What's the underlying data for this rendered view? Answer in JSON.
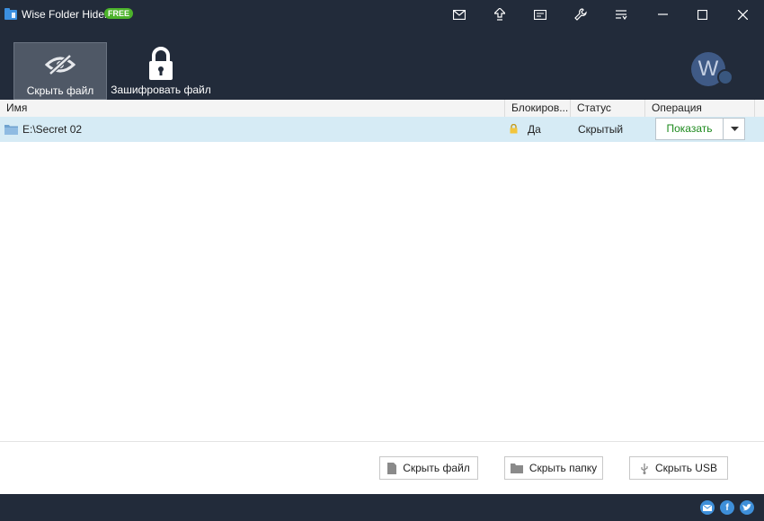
{
  "app": {
    "title": "Wise Folder Hider",
    "badge": "FREE"
  },
  "titlebar_icons": [
    "mail-icon",
    "upgrade-icon",
    "feedback-icon",
    "settings-icon",
    "menu-icon"
  ],
  "window_controls": [
    "minimize",
    "maximize",
    "close"
  ],
  "toolbar": {
    "hide_file": "Скрыть файл",
    "encrypt_file": "Зашифровать файл"
  },
  "avatar": {
    "letter": "W"
  },
  "table": {
    "columns": [
      "Имя",
      "Блокиров...",
      "Статус",
      "Операция"
    ],
    "rows": [
      {
        "name": "E:\\Secret 02",
        "locked": "Да",
        "status": "Скрытый",
        "operation": "Показать"
      }
    ]
  },
  "actions": {
    "hide_file": "Скрыть файл",
    "hide_folder": "Скрыть папку",
    "hide_usb": "Скрыть USB"
  },
  "social": [
    "email",
    "f",
    "twitter"
  ],
  "colors": {
    "chrome": "#222b3a",
    "row_selected": "#d6ebf5",
    "show_text": "#1e8a1e",
    "badge": "#4cb32b"
  }
}
